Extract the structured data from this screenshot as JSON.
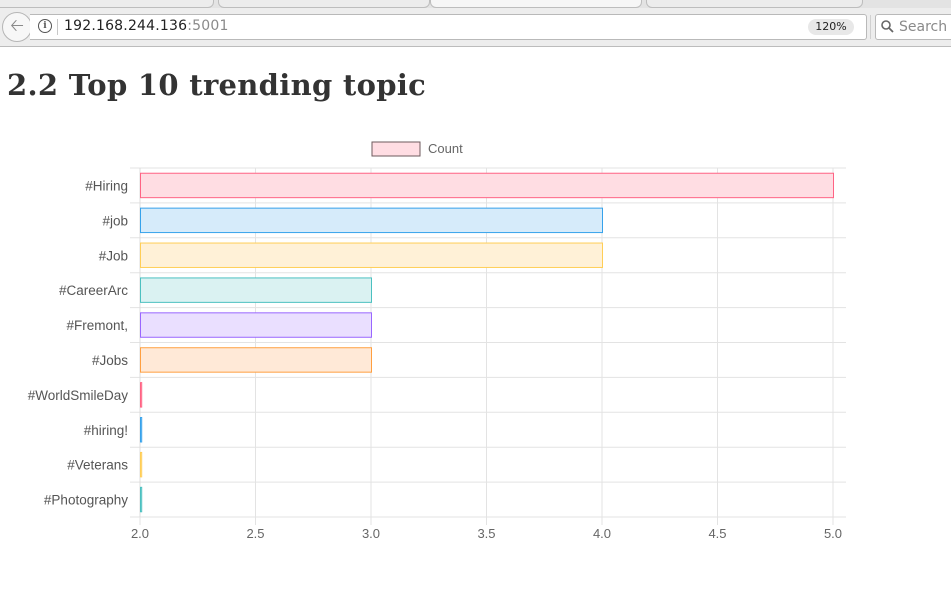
{
  "browser": {
    "url_host": "192.168.244.136",
    "url_port": ":5001",
    "zoom": "120%",
    "search_placeholder": "Search",
    "icons": {
      "back": "back-arrow-icon",
      "info": "info-icon",
      "reload": "reload-icon",
      "search": "search-icon"
    }
  },
  "page": {
    "title": "2.2 Top 10 trending topic"
  },
  "chart_data": {
    "type": "bar",
    "orientation": "horizontal",
    "categories": [
      "#Hiring",
      "#job",
      "#Job",
      "#CareerArc",
      "#Fremont,",
      "#Jobs",
      "#WorldSmileDay",
      "#hiring!",
      "#Veterans",
      "#Photography"
    ],
    "series": [
      {
        "name": "Count",
        "values": [
          5,
          4,
          4,
          3,
          3,
          3,
          2,
          2,
          2,
          2
        ]
      }
    ],
    "xlim": [
      2.0,
      5.0
    ],
    "xticks": [
      "2.0",
      "2.5",
      "3.0",
      "3.5",
      "4.0",
      "4.5",
      "5.0"
    ],
    "grid": true,
    "legend_position": "top",
    "bar_fill_colors": [
      "#ffdde3",
      "#d6ebfa",
      "#fff1d7",
      "#daf2f2",
      "#eadfff",
      "#ffe9d7",
      "#ffdde3",
      "#d6ebfa",
      "#fff1d7",
      "#daf2f2"
    ],
    "bar_border_colors": [
      "#ff6384",
      "#36a2eb",
      "#ffce56",
      "#4bc0c0",
      "#9966ff",
      "#ff9f40",
      "#ff6384",
      "#36a2eb",
      "#ffce56",
      "#4bc0c0"
    ],
    "legend_fill": "#ffdde3",
    "legend_border": "#6d5a5e"
  }
}
